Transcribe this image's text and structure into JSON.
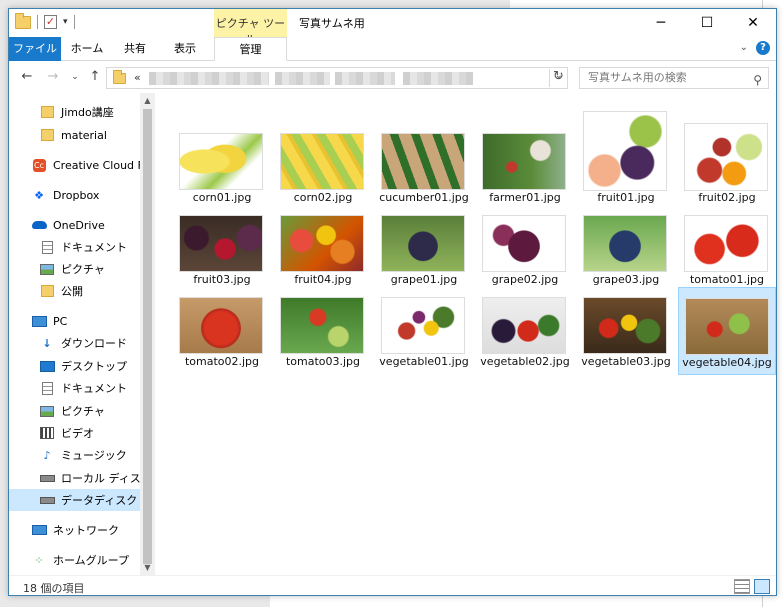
{
  "window": {
    "title": "写真サムネ用",
    "contextual_group": "ピクチャ ツール",
    "controls": {
      "minimize": "─",
      "maximize": "☐",
      "close": "✕"
    }
  },
  "ribbon": {
    "file_tab": "ファイル",
    "tabs": [
      "ホーム",
      "共有",
      "表示",
      "管理"
    ],
    "active_tab": "管理",
    "help": "?",
    "collapse": "⌄"
  },
  "address": {
    "prefix": "«",
    "search_placeholder": "写真サムネ用の検索"
  },
  "sidebar": {
    "items": [
      {
        "label": "Jimdo講座",
        "icon": "folder-icon"
      },
      {
        "label": "material",
        "icon": "folder-icon"
      },
      {
        "label": "Creative Cloud Files",
        "icon": "creative-cloud-icon"
      },
      {
        "label": "Dropbox",
        "icon": "dropbox-icon"
      },
      {
        "label": "OneDrive",
        "icon": "onedrive-icon"
      },
      {
        "label": "ドキュメント",
        "icon": "document-icon"
      },
      {
        "label": "ピクチャ",
        "icon": "pictures-icon"
      },
      {
        "label": "公開",
        "icon": "folder-icon"
      },
      {
        "label": "PC",
        "icon": "pc-icon"
      },
      {
        "label": "ダウンロード",
        "icon": "download-icon"
      },
      {
        "label": "デスクトップ",
        "icon": "desktop-icon"
      },
      {
        "label": "ドキュメント",
        "icon": "document-icon"
      },
      {
        "label": "ピクチャ",
        "icon": "pictures-icon"
      },
      {
        "label": "ビデオ",
        "icon": "video-icon"
      },
      {
        "label": "ミュージック",
        "icon": "music-icon"
      },
      {
        "label": "ローカル ディスク (C:)",
        "icon": "local-disk-icon"
      },
      {
        "label": "データディスク (D:)",
        "icon": "data-disk-icon"
      },
      {
        "label": "ネットワーク",
        "icon": "network-icon"
      },
      {
        "label": "ホームグループ",
        "icon": "homegroup-icon"
      }
    ],
    "selected": "データディスク (D:)"
  },
  "files": [
    {
      "name": "corn01.jpg"
    },
    {
      "name": "corn02.jpg"
    },
    {
      "name": "cucumber01.jpg"
    },
    {
      "name": "farmer01.jpg"
    },
    {
      "name": "fruit01.jpg"
    },
    {
      "name": "fruit02.jpg"
    },
    {
      "name": "fruit03.jpg"
    },
    {
      "name": "fruit04.jpg"
    },
    {
      "name": "grape01.jpg"
    },
    {
      "name": "grape02.jpg"
    },
    {
      "name": "grape03.jpg"
    },
    {
      "name": "tomato01.jpg"
    },
    {
      "name": "tomato02.jpg"
    },
    {
      "name": "tomato03.jpg"
    },
    {
      "name": "vegetable01.jpg"
    },
    {
      "name": "vegetable02.jpg"
    },
    {
      "name": "vegetable03.jpg"
    },
    {
      "name": "vegetable04.jpg"
    }
  ],
  "selected_file": "vegetable04.jpg",
  "status": {
    "count_text": "18 個の項目"
  }
}
